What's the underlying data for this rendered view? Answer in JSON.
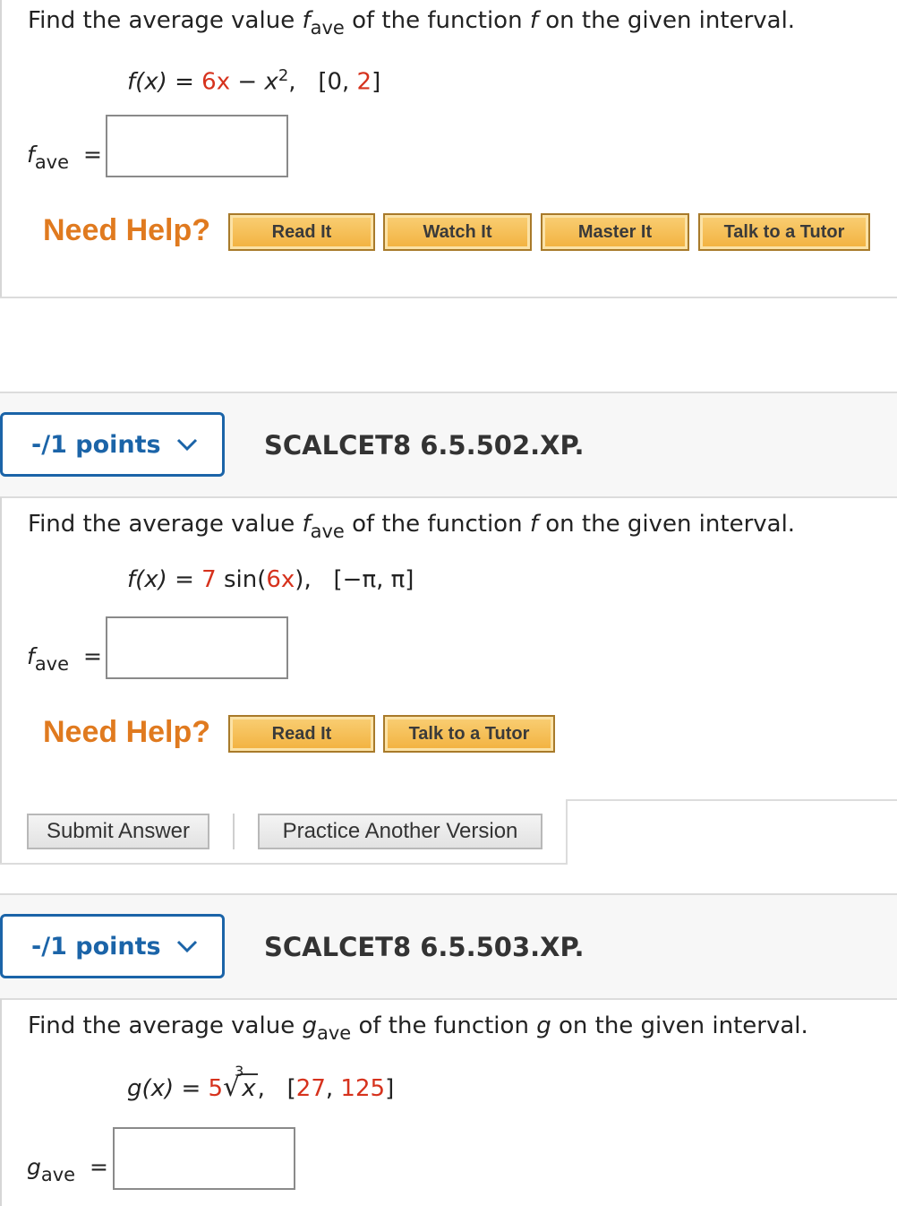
{
  "colors": {
    "accent_blue": "#1b64a8",
    "highlight_red": "#d6321d",
    "help_orange": "#e07a1f"
  },
  "q1": {
    "prompt_pre": "Find the average value ",
    "prompt_var": "f",
    "prompt_sub": "ave",
    "prompt_post": " of the function ",
    "prompt_fn": "f",
    "prompt_end": " on the given interval.",
    "fx_label": "f(x)",
    "equals": "=",
    "term1": "6x",
    "minus": "−",
    "term2": "x",
    "power": "2",
    "comma": ",",
    "interval_open": "[0,",
    "interval_val": "2",
    "interval_close": "]",
    "answer_var": "f",
    "answer_sub": "ave",
    "answer_eq": "=",
    "need_help": "Need Help?",
    "buttons": [
      "Read It",
      "Watch It",
      "Master It",
      "Talk to a Tutor"
    ]
  },
  "q2": {
    "points": "-/1 points",
    "code": "SCALCET8 6.5.502.XP.",
    "prompt_pre": "Find the average value ",
    "prompt_var": "f",
    "prompt_sub": "ave",
    "prompt_post": " of the function ",
    "prompt_fn": "f",
    "prompt_end": " on the given interval.",
    "fx_label": "f(x)",
    "equals": "=",
    "coef": "7",
    "sin_open": " sin(",
    "arg": "6x",
    "sin_close": "),",
    "interval": "[−π, π]",
    "answer_var": "f",
    "answer_sub": "ave",
    "answer_eq": "=",
    "need_help": "Need Help?",
    "buttons": [
      "Read It",
      "Talk to a Tutor"
    ],
    "submit": "Submit Answer",
    "practice": "Practice Another Version"
  },
  "q3": {
    "points": "-/1 points",
    "code": "SCALCET8 6.5.503.XP.",
    "prompt_pre": "Find the average value ",
    "prompt_var": "g",
    "prompt_sub": "ave",
    "prompt_post": " of the function ",
    "prompt_fn": "g",
    "prompt_end": " on the given interval.",
    "gx_label": "g(x)",
    "equals": "=",
    "coef": "5",
    "root_index": "3",
    "radicand": "x",
    "comma": ",",
    "interval_open": "[",
    "interval_a": "27",
    "interval_sep": ", ",
    "interval_b": "125",
    "interval_close": "]",
    "answer_var": "g",
    "answer_sub": "ave",
    "answer_eq": "="
  }
}
